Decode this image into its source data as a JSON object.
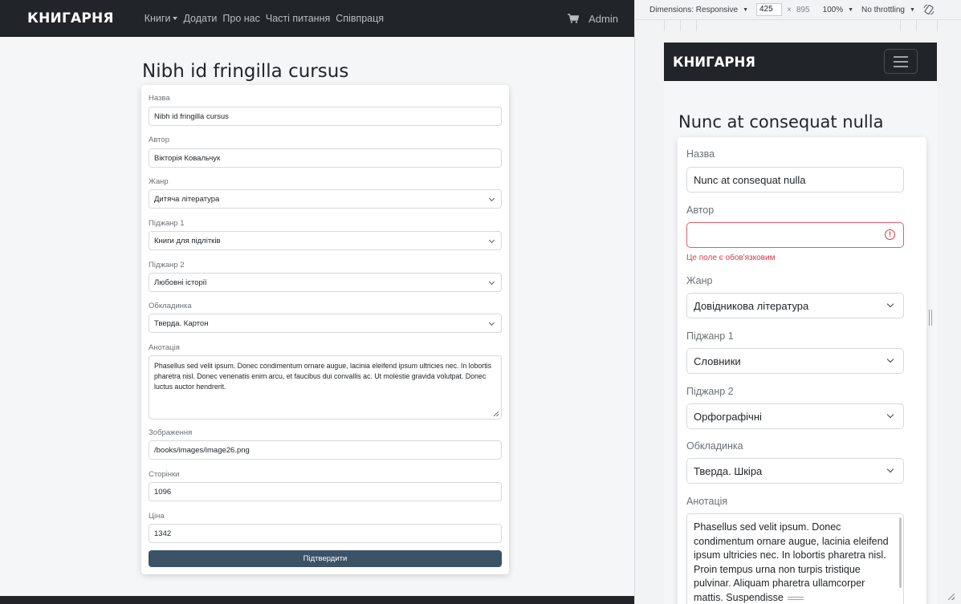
{
  "desktop": {
    "brand": "КНИГАРНЯ",
    "nav": [
      "Книги",
      "Додати",
      "Про нас",
      "Часті питання",
      "Співпраця"
    ],
    "admin": "Admin",
    "page_title": "Nibh id fringilla cursus",
    "fields": {
      "title_label": "Назва",
      "title_value": "Nibh id fringilla cursus",
      "author_label": "Автор",
      "author_value": "Вікторія Ковальчук",
      "genre_label": "Жанр",
      "genre_value": "Дитяча література",
      "sub1_label": "Піджанр 1",
      "sub1_value": "Книги для підлітків",
      "sub2_label": "Піджанр 2",
      "sub2_value": "Любовні історії",
      "cover_label": "Обкладинка",
      "cover_value": "Тверда. Картон",
      "annotation_label": "Анотація",
      "annotation_value": "Phasellus sed velit ipsum. Donec condimentum ornare augue, lacinia eleifend ipsum ultricies nec. In lobortis pharetra nisl. Donec venenatis enim arcu, et faucibus dui convallis ac. Ut molestie gravida volutpat. Donec luctus auctor hendrerit.",
      "image_label": "Зображення",
      "image_value": "/books/images/image26.png",
      "pages_label": "Сторінки",
      "pages_value": "1096",
      "price_label": "Ціна",
      "price_value": "1342"
    },
    "submit": "Підтвердити"
  },
  "devtools": {
    "dimensions_label": "Dimensions: Responsive",
    "width": "425",
    "height": "895",
    "x": "×",
    "zoom": "100%",
    "throttle": "No throttling"
  },
  "mobile": {
    "brand": "КНИГАРНЯ",
    "page_title": "Nunc at consequat nulla",
    "fields": {
      "title_label": "Назва",
      "title_value": "Nunc at consequat nulla",
      "author_label": "Автор",
      "author_value": "",
      "author_error": "Це поле є обов'язковим",
      "genre_label": "Жанр",
      "genre_value": "Довідникова література",
      "sub1_label": "Піджанр 1",
      "sub1_value": "Словники",
      "sub2_label": "Піджанр 2",
      "sub2_value": "Орфографічні",
      "cover_label": "Обкладинка",
      "cover_value": "Тверда. Шкіра",
      "annotation_label": "Анотація",
      "annotation_value": "Phasellus sed velit ipsum. Donec condimentum ornare augue, lacinia eleifend ipsum ultricies nec. In lobortis pharetra nisl. Proin tempus urna non turpis tristique pulvinar. Aliquam pharetra ullamcorper mattis. Suspendisse"
    }
  }
}
